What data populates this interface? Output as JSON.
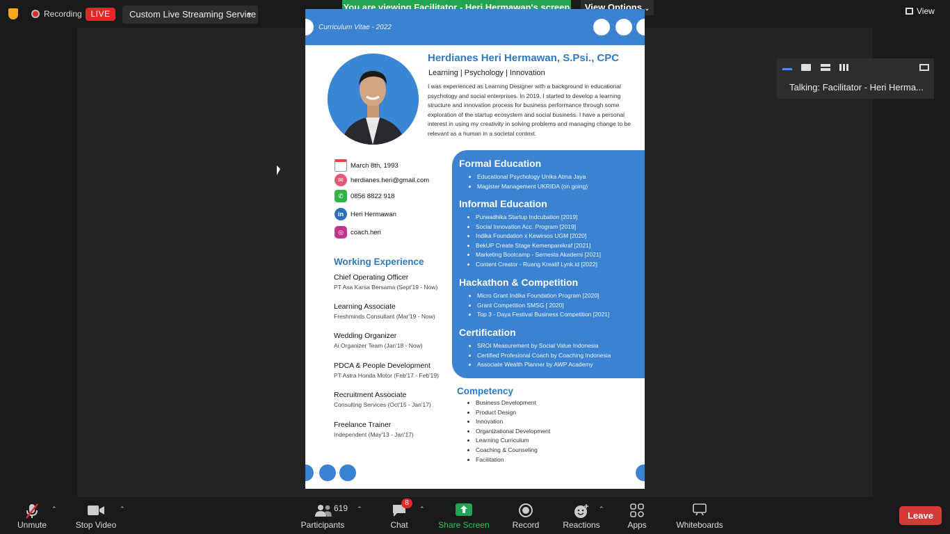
{
  "topbar": {
    "recording_label": "Recording",
    "live_badge": "LIVE",
    "stream_service": "Custom Live Streaming Service",
    "view_label": "View"
  },
  "banner": {
    "viewing_text": "You are viewing Facilitator - Heri Hermawan's screen",
    "view_options": "View Options"
  },
  "cv": {
    "header_label": "Curriculum Vitae - 2022",
    "name": "Herdianes Heri Hermawan, S.Psi., CPC",
    "tagline": "Learning | Psychology | Innovation",
    "bio": "I was experienced as Learning Designer with a background in educational psychology and social enterprises. In 2019, I started to develop a learning structure and innovation process for business performance through some exploration of the startup ecosystem and social business. I have a personal interest in using my creativity in solving problems and managing change to be relevant as a human in a societal context.",
    "contacts": [
      {
        "icon": "calendar-icon",
        "text": "March 8th, 1993"
      },
      {
        "icon": "email-icon",
        "text": "herdianes.heri@gmail.com"
      },
      {
        "icon": "whatsapp-icon",
        "text": "0856 8822 918"
      },
      {
        "icon": "linkedin-icon",
        "text": "Heri Hermawan"
      },
      {
        "icon": "instagram-icon",
        "text": "coach.heri"
      }
    ],
    "work_heading": "Working Experience",
    "jobs": [
      {
        "title": "Chief Operating Officer",
        "sub": "PT Asa Karsa Bersama (Sept'19 - Now)"
      },
      {
        "title": "Learning Associate",
        "sub": "Freshminds Consultant (Mar'19 - Now)"
      },
      {
        "title": "Wedding Organizer",
        "sub": "Ai Organizer Team (Jan'18 - Now)"
      },
      {
        "title": "PDCA & People Development",
        "sub": "PT Astra Honda Motor (Feb'17 - Feb'19)"
      },
      {
        "title": "Recruitment Associate",
        "sub": "Consulting Services (Oct'15 - Jan'17)"
      },
      {
        "title": "Freelance Trainer",
        "sub": "Independent (May'13 - Jan'17)"
      }
    ],
    "formal_heading": "Formal Education",
    "formal": [
      "Educational Psychology Unika Atma Jaya",
      "Magister Management UKRIDA (on going)"
    ],
    "informal_heading": "Informal Education",
    "informal": [
      "Purwadhika Startup Indcubation [2019]",
      "Social Innovation Acc. Program [2019]",
      "Indika Foundation x Kewirsos UGM [2020]",
      "BekUP Create Stage Kemenparekraf [2021]",
      "Marketing Bootcamp - Semesta Akademi [2021]",
      "Content Creator - Ruang Kreatif Lynk.id [2022]"
    ],
    "hackathon_heading": "Hackathon & Competition",
    "hackathon": [
      "Micro Grant Indika Foundation Program [2020]",
      "Grant Competition SMSG [ 2020]",
      "Top 3 - Daya Festival Business Competition [2021]"
    ],
    "cert_heading": "Certification",
    "cert": [
      "SROI Measurement by Social Value Indonesia",
      "Certified Profesional Coach by Coaching Indonesia",
      "Associate Wealth Planner by AWP Academy"
    ],
    "competency_heading": "Competency",
    "competency": [
      "Business Development",
      "Product Design",
      "Innovation",
      "Organizational Development",
      "Learning Curriculum",
      "Coaching & Counseling",
      "Facilitation"
    ]
  },
  "right_panel": {
    "talking": "Talking: Facilitator - Heri Herma..."
  },
  "toolbar": {
    "unmute": "Unmute",
    "stop_video": "Stop Video",
    "participants_count": "619",
    "participants": "Participants",
    "chat_badge": "8",
    "chat": "Chat",
    "share_screen": "Share Screen",
    "record": "Record",
    "reactions": "Reactions",
    "apps": "Apps",
    "whiteboards": "Whiteboards",
    "leave": "Leave"
  },
  "colors": {
    "accent_green": "#23a450",
    "live_red": "#e02828",
    "cv_blue": "#3b82d1",
    "leave_red": "#d63a36"
  }
}
